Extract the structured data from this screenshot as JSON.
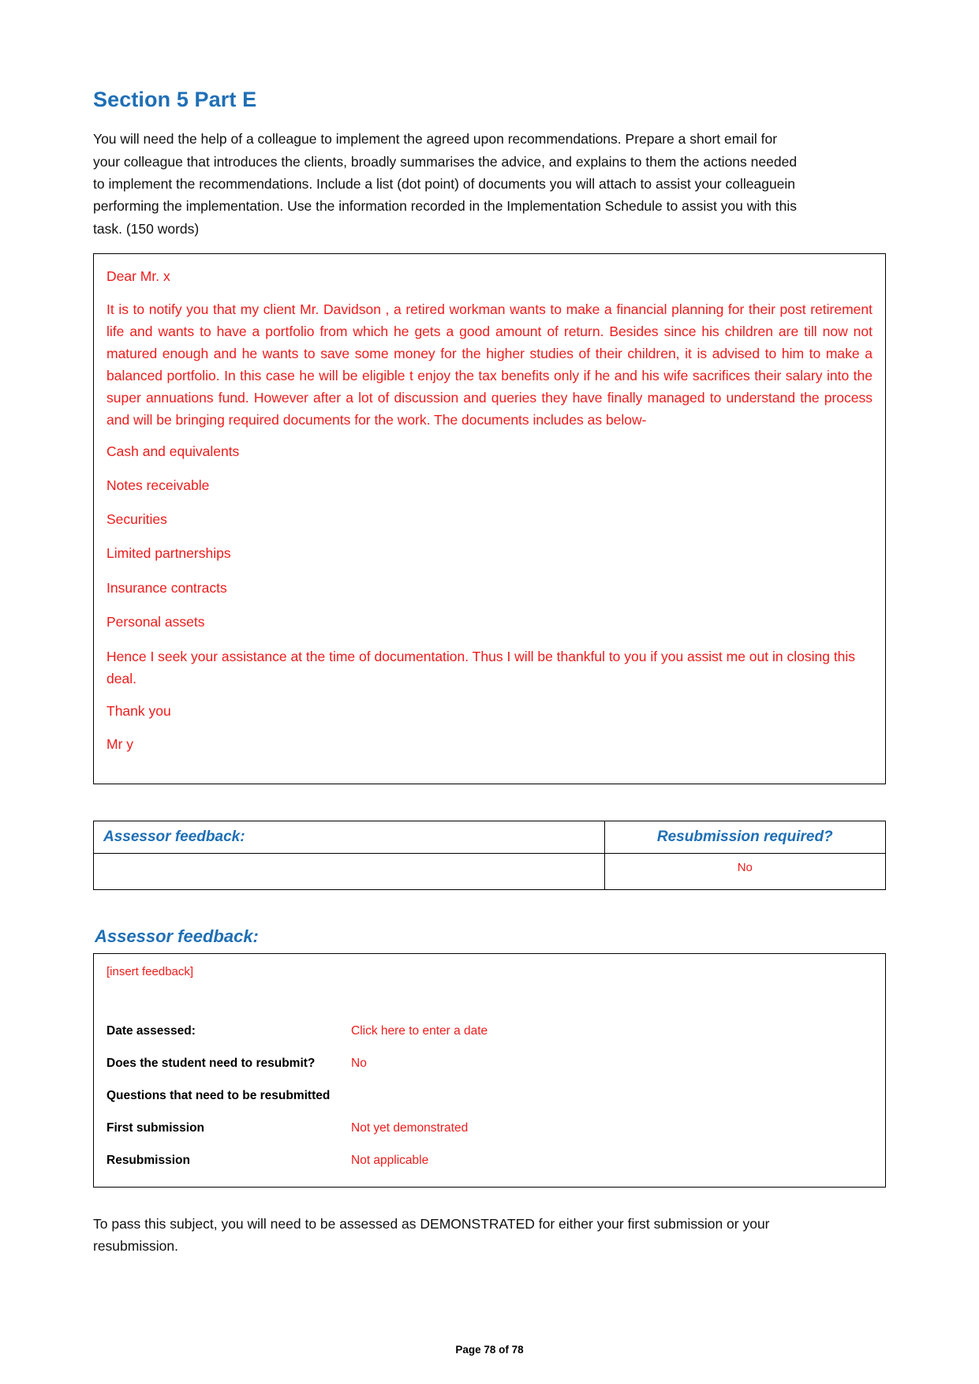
{
  "document": {
    "section_title": "Section 5 Part E",
    "instructions": "You will need the help of a colleague to implement the agreed upon recommendations. Prepare a short email for your colleague that introduces the clients, broadly summarises the advice, and explains to them the actions needed to implement the recommendations. Include a list (dot point) of documents you will attach to assist your colleaguein performing the implementation. Use the information recorded in the Implementation Schedule to assist you with this task. (150 words)",
    "footer": "Page 78 of 78",
    "closing_note": "To pass this subject, you will need to be assessed as DEMONSTRATED for either your first submission or your resubmission."
  },
  "answer": {
    "salutation": "Dear Mr. x",
    "body": "It is to notify you that my client Mr. Davidson , a retired workman wants to make a financial planning for their post retirement life and wants to have a portfolio from which he gets a good amount of return. Besides since his children are till now not matured enough and he wants to save some money for the higher studies of their children, it is advised to him to make a balanced portfolio. In this case he will be eligible t enjoy the tax benefits only if he and his wife sacrifices their salary into the super annuations fund. However after a lot of discussion and queries they have finally managed to understand the process and will be bringing required documents for the work.  The documents includes as below-",
    "documents": [
      "Cash and equivalents",
      "Notes receivable",
      "Securities",
      "Limited partnerships",
      "Insurance contracts",
      "Personal assets"
    ],
    "request": " Hence I seek your assistance at the time of documentation. Thus I will be thankful to you if you assist me out in closing this deal.",
    "thanks": "Thank you",
    "signature": "Mr y"
  },
  "feedback_table": {
    "header_feedback": "Assessor feedback:",
    "header_resubmission": "Resubmission required?",
    "feedback_value": "",
    "resubmission_value": "No"
  },
  "assessor_feedback": {
    "title": "Assessor feedback:",
    "insert_placeholder": "[insert feedback]",
    "rows": [
      {
        "label": "Date assessed:",
        "value": "Click here to enter a date"
      },
      {
        "label": "Does the student need to resubmit?",
        "value": "No"
      },
      {
        "label": "Questions that need to be resubmitted",
        "value": ""
      },
      {
        "label": "First submission",
        "value": "Not yet demonstrated"
      },
      {
        "label": "Resubmission",
        "value": "Not applicable"
      }
    ]
  },
  "colors": {
    "heading_blue": "#1f6fb5",
    "answer_red": "#ee1c1c",
    "body_black": "#111111"
  }
}
